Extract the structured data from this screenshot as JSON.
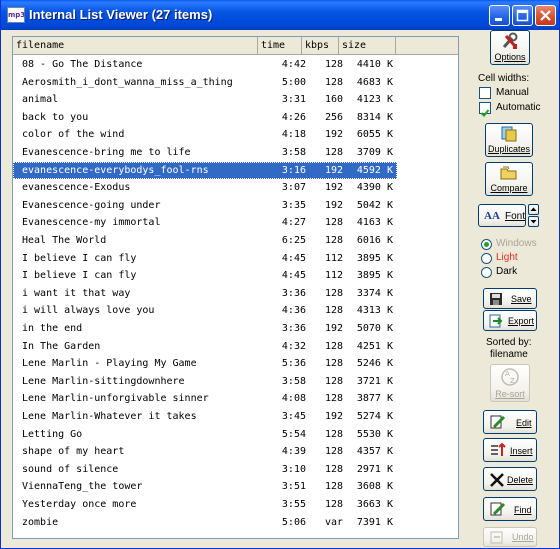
{
  "window": {
    "title": "Internal List Viewer (27 items)",
    "app_icon_text": "mp3"
  },
  "table": {
    "columns": [
      "filename",
      "time",
      "kbps",
      "size"
    ],
    "selected_index": 6,
    "rows": [
      {
        "filename": "08 - Go The Distance",
        "time": "4:42",
        "kbps": "128",
        "size": "4410 K"
      },
      {
        "filename": "Aerosmith_i_dont_wanna_miss_a_thing",
        "time": "5:00",
        "kbps": "128",
        "size": "4683 K"
      },
      {
        "filename": "animal",
        "time": "3:31",
        "kbps": "160",
        "size": "4123 K"
      },
      {
        "filename": "back to you",
        "time": "4:26",
        "kbps": "256",
        "size": "8314 K"
      },
      {
        "filename": "color of the wind",
        "time": "4:18",
        "kbps": "192",
        "size": "6055 K"
      },
      {
        "filename": "Evanescence-bring me to life",
        "time": "3:58",
        "kbps": "128",
        "size": "3709 K"
      },
      {
        "filename": "evanescence-everybodys_fool-rns",
        "time": "3:16",
        "kbps": "192",
        "size": "4592 K"
      },
      {
        "filename": "evanescence-Exodus",
        "time": "3:07",
        "kbps": "192",
        "size": "4390 K"
      },
      {
        "filename": "Evanescence-going under",
        "time": "3:35",
        "kbps": "192",
        "size": "5042 K"
      },
      {
        "filename": "Evanescence-my immortal",
        "time": "4:27",
        "kbps": "128",
        "size": "4163 K"
      },
      {
        "filename": "Heal The World",
        "time": "6:25",
        "kbps": "128",
        "size": "6016 K"
      },
      {
        "filename": "I believe I can fly",
        "time": "4:45",
        "kbps": "112",
        "size": "3895 K"
      },
      {
        "filename": "I believe I can fly",
        "time": "4:45",
        "kbps": "112",
        "size": "3895 K"
      },
      {
        "filename": "i want it that way",
        "time": "3:36",
        "kbps": "128",
        "size": "3374 K"
      },
      {
        "filename": "i will always love you",
        "time": "4:36",
        "kbps": "128",
        "size": "4313 K"
      },
      {
        "filename": "in the end",
        "time": "3:36",
        "kbps": "192",
        "size": "5070 K"
      },
      {
        "filename": "In The Garden",
        "time": "4:32",
        "kbps": "128",
        "size": "4251 K"
      },
      {
        "filename": "Lene Marlin - Playing My Game",
        "time": "5:36",
        "kbps": "128",
        "size": "5246 K"
      },
      {
        "filename": "Lene Marlin-sittingdownhere",
        "time": "3:58",
        "kbps": "128",
        "size": "3721 K"
      },
      {
        "filename": "Lene Marlin-unforgivable sinner",
        "time": "4:08",
        "kbps": "128",
        "size": "3877 K"
      },
      {
        "filename": "Lene Marlin-Whatever it takes",
        "time": "3:45",
        "kbps": "192",
        "size": "5274 K"
      },
      {
        "filename": "Letting Go",
        "time": "5:54",
        "kbps": "128",
        "size": "5530 K"
      },
      {
        "filename": "shape of my heart",
        "time": "4:39",
        "kbps": "128",
        "size": "4357 K"
      },
      {
        "filename": "sound of silence",
        "time": "3:10",
        "kbps": "128",
        "size": "2971 K"
      },
      {
        "filename": "ViennaTeng_the tower",
        "time": "3:51",
        "kbps": "128",
        "size": "3608 K"
      },
      {
        "filename": "Yesterday once more",
        "time": "3:55",
        "kbps": "128",
        "size": "3663 K"
      },
      {
        "filename": "zombie",
        "time": "5:06",
        "kbps": "var",
        "size": "7391 K"
      }
    ]
  },
  "sidebar": {
    "options_label": "Options",
    "cell_widths_label": "Cell widths:",
    "manual_label": "Manual",
    "manual_checked": false,
    "automatic_label": "Automatic",
    "automatic_checked": true,
    "duplicates_label": "Duplicates",
    "compare_label": "Compare",
    "font_label": "Font",
    "font_glyph": "AA",
    "theme_options": [
      "Windows",
      "Light",
      "Dark"
    ],
    "theme_selected": "Windows",
    "save_label": "Save",
    "export_label": "Export",
    "sorted_by_label": "Sorted by:",
    "sorted_by_value": "filename",
    "resort_label": "Re-sort",
    "edit_label": "Edit",
    "insert_label": "Insert",
    "delete_label": "Delete",
    "find_label": "Find",
    "undo_label": "Undo"
  },
  "colors": {
    "selection": "#316ac5",
    "light_theme_text": "#e0301e",
    "title_bar": "#0054e3"
  }
}
